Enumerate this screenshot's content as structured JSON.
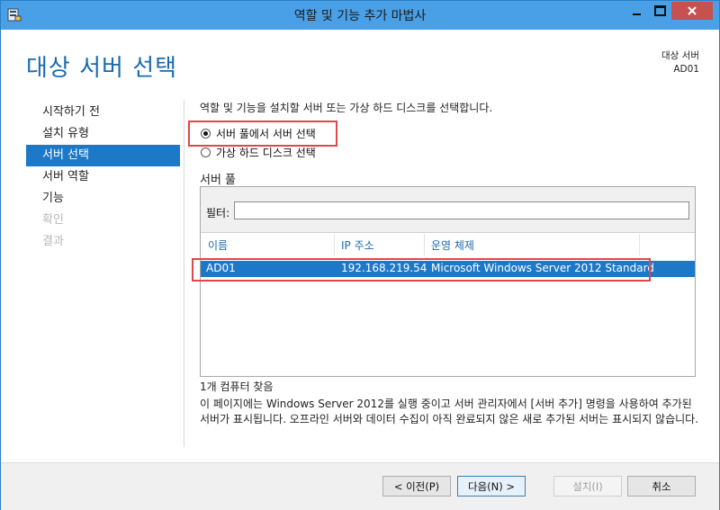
{
  "window": {
    "title": "역할 및 기능 추가 마법사"
  },
  "header": {
    "page_title": "대상 서버 선택",
    "destination_label": "대상 서버",
    "destination_value": "AD01"
  },
  "nav": {
    "items": [
      {
        "label": "시작하기 전",
        "state": "normal"
      },
      {
        "label": "설치 유형",
        "state": "normal"
      },
      {
        "label": "서버 선택",
        "state": "active"
      },
      {
        "label": "서버 역할",
        "state": "normal"
      },
      {
        "label": "기능",
        "state": "normal"
      },
      {
        "label": "확인",
        "state": "disabled"
      },
      {
        "label": "결과",
        "state": "disabled"
      }
    ]
  },
  "content": {
    "instruction": "역할 및 기능을 설치할 서버 또는 가상 하드 디스크를 선택합니다.",
    "radio_pool": "서버 풀에서 서버 선택",
    "radio_vhd": "가상 하드 디스크 선택",
    "section_label": "서버 풀",
    "filter_label": "필터:",
    "filter_value": "",
    "columns": [
      "이름",
      "IP 주소",
      "운영 체제"
    ],
    "rows": [
      {
        "name": "AD01",
        "ip": "192.168.219.54",
        "os": "Microsoft Windows Server 2012 Standard"
      }
    ],
    "found_text": "1개 컴퓨터 찾음",
    "description": "이 페이지에는 Windows Server 2012를 실행 중이고 서버 관리자에서 [서버 추가] 명령을 사용하여 추가된 서버가 표시됩니다. 오프라인 서버와 데이터 수집이 아직 완료되지 않은 새로 추가된 서버는 표시되지 않습니다."
  },
  "footer": {
    "prev": "< 이전(P)",
    "next": "다음(N) >",
    "install": "설치(I)",
    "cancel": "취소"
  },
  "colors": {
    "titlebar": "#4aa0e6",
    "accent": "#1e78c8",
    "heading": "#1a6ab0",
    "highlight": "#e04848",
    "close": "#c75050"
  }
}
